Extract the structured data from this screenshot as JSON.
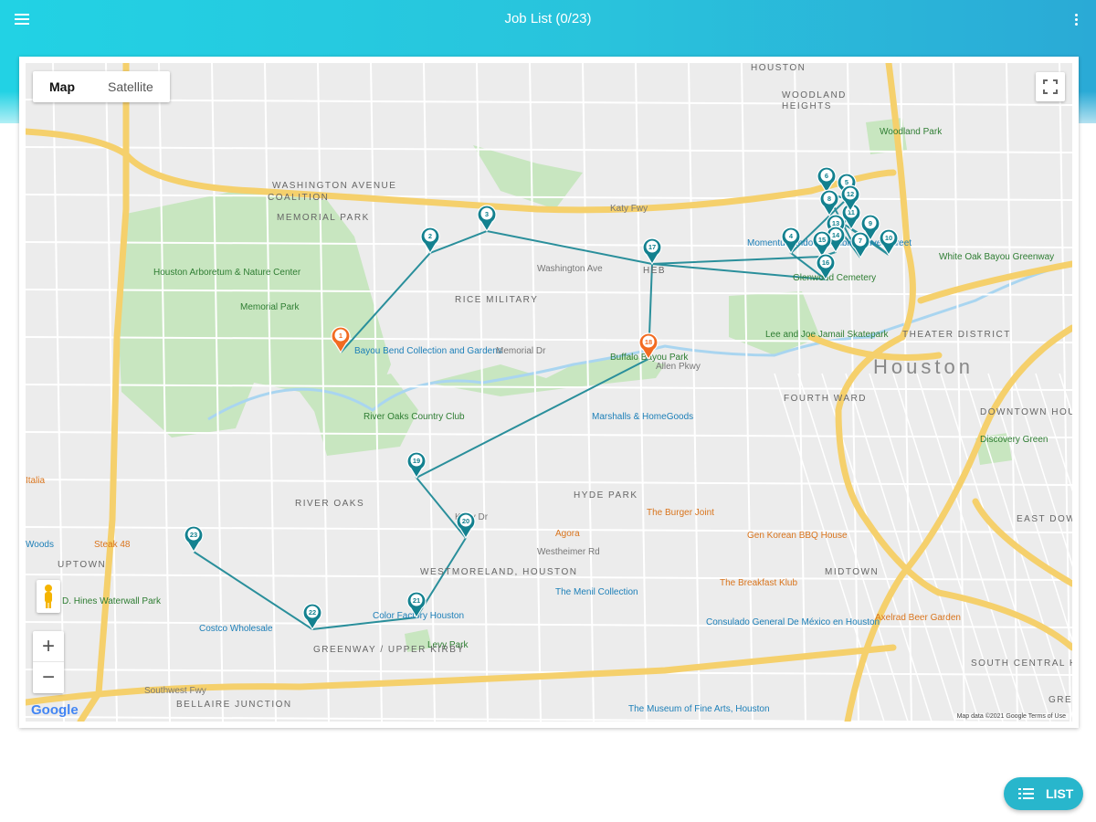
{
  "header": {
    "title": "Job List (0/23)"
  },
  "map": {
    "type_control": {
      "map_label": "Map",
      "satellite_label": "Satellite",
      "selected": "Map"
    },
    "zoom_in_label": "+",
    "zoom_out_label": "−",
    "google_logo": "Google",
    "attribution": "Map data ©2021 Google  Terms of Use",
    "labels": [
      "HOUSTON",
      "WOODLAND",
      "HEIGHTS",
      "Woodland Park",
      "WASHINGTON AVENUE",
      "COALITION",
      "MEMORIAL PARK",
      "Houston Arboretum & Nature Center",
      "Memorial Park",
      "Bayou Bend Collection and Gardens",
      "RICE MILITARY",
      "Momentum Indoor Climbing Silver Street",
      "Glenwood Cemetery",
      "White Oak Bayou Greenway",
      "THEATER DISTRICT",
      "Houston",
      "Buffalo Bayou Park",
      "Lee and Joe Jamail Skatepark",
      "FOURTH WARD",
      "River Oaks Country Club",
      "Marshalls & HomeGoods",
      "DOWNTOWN HOUSTON",
      "Discovery Green",
      "RIVER OAKS",
      "HYDE PARK",
      "The Burger Joint",
      "Agora",
      "Gen Korean BBQ House",
      "EAST DOWNTOWN",
      "WESTMORELAND, HOUSTON",
      "The Menil Collection",
      "MIDTOWN",
      "The Breakfast Klub",
      "Color Factory Houston",
      "Costco Wholesale",
      "Consulado General De México en Houston",
      "Axelrad Beer Garden",
      "UPTOWN",
      "D. Hines Waterwall Park",
      "Levy Park",
      "GREENWAY / UPPER KIRBY",
      "SOUTH CENTRAL HOUSTON",
      "BELLAIRE JUNCTION",
      "The Museum of Fine Arts, Houston",
      "Steak 48",
      "HEB",
      "Kirby Dr",
      "Westheimer Rd",
      "Allen Pkwy",
      "Memorial Dr",
      "Washington Ave",
      "Katy Fwy",
      "Southwest Fwy",
      "GREAT",
      "Italia",
      "Woods"
    ],
    "markers": [
      {
        "label": "1",
        "status": "current"
      },
      {
        "label": "2",
        "status": "pending"
      },
      {
        "label": "3",
        "status": "pending"
      },
      {
        "label": "4",
        "status": "pending"
      },
      {
        "label": "5",
        "status": "pending"
      },
      {
        "label": "6",
        "status": "pending"
      },
      {
        "label": "7",
        "status": "pending"
      },
      {
        "label": "8",
        "status": "pending"
      },
      {
        "label": "9",
        "status": "pending"
      },
      {
        "label": "10",
        "status": "pending"
      },
      {
        "label": "11",
        "status": "pending"
      },
      {
        "label": "12",
        "status": "pending"
      },
      {
        "label": "13",
        "status": "pending"
      },
      {
        "label": "14",
        "status": "pending"
      },
      {
        "label": "15",
        "status": "pending"
      },
      {
        "label": "16",
        "status": "pending"
      },
      {
        "label": "17",
        "status": "pending"
      },
      {
        "label": "18",
        "status": "current"
      },
      {
        "label": "19",
        "status": "pending"
      },
      {
        "label": "20",
        "status": "pending"
      },
      {
        "label": "21",
        "status": "pending"
      },
      {
        "label": "22",
        "status": "pending"
      },
      {
        "label": "23",
        "status": "pending"
      }
    ],
    "colors": {
      "route": "#2a8f9b",
      "pin": "#13818f",
      "pin_current": "#f26b21",
      "park": "#c8e6c0",
      "highway": "#f7d36b"
    }
  },
  "fab": {
    "label": "LIST"
  }
}
